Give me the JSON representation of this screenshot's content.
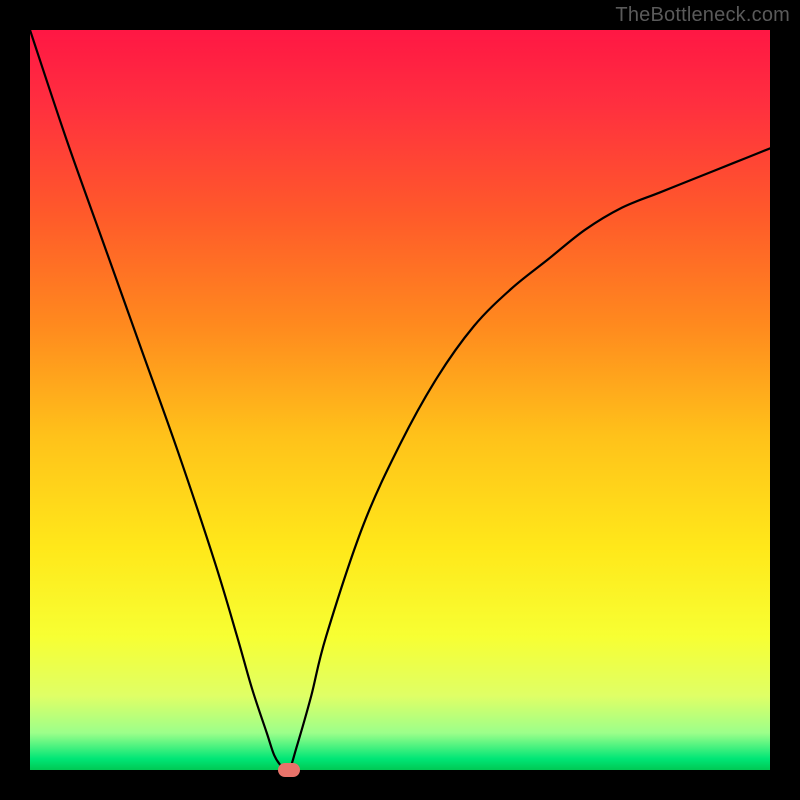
{
  "watermark": "TheBottleneck.com",
  "chart_data": {
    "type": "line",
    "title": "",
    "xlabel": "",
    "ylabel": "",
    "xlim": [
      0,
      100
    ],
    "ylim": [
      0,
      100
    ],
    "background_gradient": {
      "orientation": "vertical",
      "stops": [
        {
          "pos": 0.0,
          "color": "#ff1744"
        },
        {
          "pos": 0.1,
          "color": "#ff2f3f"
        },
        {
          "pos": 0.25,
          "color": "#ff5a2a"
        },
        {
          "pos": 0.4,
          "color": "#ff8a1e"
        },
        {
          "pos": 0.55,
          "color": "#ffc21a"
        },
        {
          "pos": 0.7,
          "color": "#ffe81a"
        },
        {
          "pos": 0.82,
          "color": "#f7ff33"
        },
        {
          "pos": 0.9,
          "color": "#dfff66"
        },
        {
          "pos": 0.95,
          "color": "#9cff8a"
        },
        {
          "pos": 0.985,
          "color": "#00e676"
        },
        {
          "pos": 1.0,
          "color": "#00c853"
        }
      ]
    },
    "series": [
      {
        "name": "bottleneck-curve",
        "color": "#000000",
        "x": [
          0,
          5,
          10,
          15,
          20,
          25,
          28,
          30,
          32,
          33,
          34,
          35,
          36,
          38,
          40,
          45,
          50,
          55,
          60,
          65,
          70,
          75,
          80,
          85,
          90,
          95,
          100
        ],
        "values": [
          100,
          85,
          71,
          57,
          43,
          28,
          18,
          11,
          5,
          2,
          0.5,
          0,
          3,
          10,
          18,
          33,
          44,
          53,
          60,
          65,
          69,
          73,
          76,
          78,
          80,
          82,
          84
        ]
      }
    ],
    "marker": {
      "name": "optimal-point",
      "x": 35,
      "y": 0,
      "color": "#e8736a"
    }
  }
}
